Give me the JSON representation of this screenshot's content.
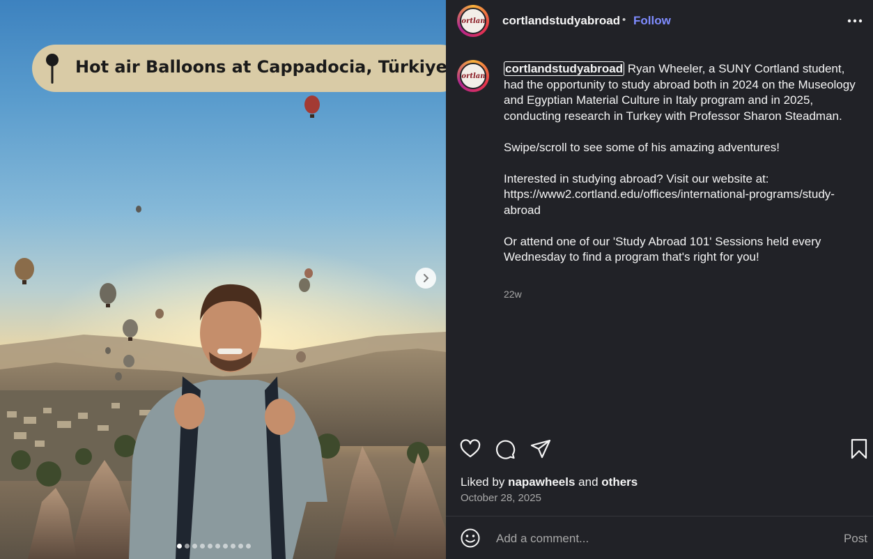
{
  "media": {
    "location_title": "Hot air Balloons at Cappadocia, Türkiye",
    "carousel_count": 10,
    "carousel_active": 0,
    "pin_icon": "map-pin-icon",
    "next_icon": "chevron-right-icon"
  },
  "header": {
    "username": "cortlandstudyabroad",
    "separator": "•",
    "follow_label": "Follow",
    "avatar_text": "Cortland",
    "more_icon": "more-options-icon"
  },
  "caption": {
    "username": "cortlandstudyabroad",
    "first_text": " Ryan Wheeler, a SUNY Cortland student, had the opportunity to study abroad both in 2024 on the Museology and Egyptian Material Culture in Italy program and in 2025, conducting research in Turkey with Professor Sharon Steadman.",
    "para2": "Swipe/scroll to see some of his amazing adventures!",
    "para3_line1": "Interested in studying abroad? Visit our website at:",
    "para3_line2": "https://www2.cortland.edu/offices/international-programs/study-abroad",
    "para4": "Or attend one of our 'Study Abroad 101' Sessions held every Wednesday to find a program that's right for you!",
    "time_ago": "22w"
  },
  "actions": {
    "icons": [
      "heart-icon",
      "comment-icon",
      "share-icon",
      "bookmark-icon"
    ]
  },
  "likes": {
    "prefix": "Liked by",
    "user": "napawheels",
    "conjunction": "and",
    "others": "others"
  },
  "post_date": "October 28, 2025",
  "comment": {
    "placeholder": "Add a comment...",
    "post_label": "Post",
    "emoji_icon": "emoji-icon"
  },
  "colors": {
    "panel_bg": "#212227",
    "follow": "#7f8cff",
    "location_pill": "#d9cba6"
  }
}
